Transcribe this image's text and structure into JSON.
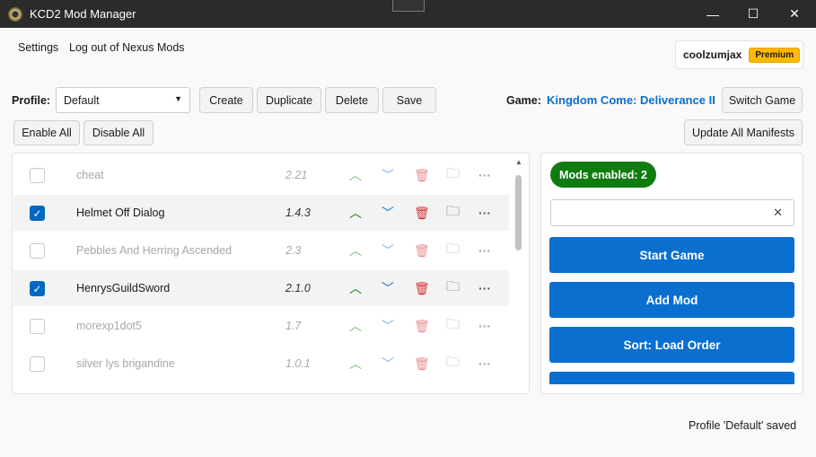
{
  "window": {
    "title": "KCD2 Mod Manager",
    "minimize": "—",
    "maximize": "☐",
    "close": "✕"
  },
  "menu": {
    "settings": "Settings",
    "logout": "Log out of Nexus Mods"
  },
  "user": {
    "name": "coolzumjax",
    "badge": "Premium"
  },
  "profile": {
    "label": "Profile:",
    "selected": "Default",
    "create": "Create",
    "duplicate": "Duplicate",
    "delete": "Delete",
    "save": "Save"
  },
  "game": {
    "label": "Game:",
    "name": "Kingdom Come: Deliverance II",
    "switch": "Switch Game"
  },
  "actions": {
    "enable_all": "Enable All",
    "disable_all": "Disable All",
    "update_manifests": "Update All Manifests"
  },
  "mods": [
    {
      "name": "cheat",
      "version": "2.21",
      "enabled": false
    },
    {
      "name": "Helmet Off Dialog",
      "version": "1.4.3",
      "enabled": true
    },
    {
      "name": "Pebbles And Herring Ascended",
      "version": "2.3",
      "enabled": false
    },
    {
      "name": "HenrysGuildSword",
      "version": "2.1.0",
      "enabled": true
    },
    {
      "name": "morexp1dot5",
      "version": "1.7",
      "enabled": false
    },
    {
      "name": "silver lys brigandine",
      "version": "1.0.1",
      "enabled": false
    }
  ],
  "side": {
    "mods_enabled": "Mods enabled: 2",
    "search_value": "",
    "start": "Start Game",
    "add": "Add Mod",
    "sort": "Sort: Load Order"
  },
  "status": "Profile 'Default' saved",
  "colors": {
    "accent": "#0a6fcf",
    "green": "#107c10",
    "premium": "#ffb900"
  }
}
